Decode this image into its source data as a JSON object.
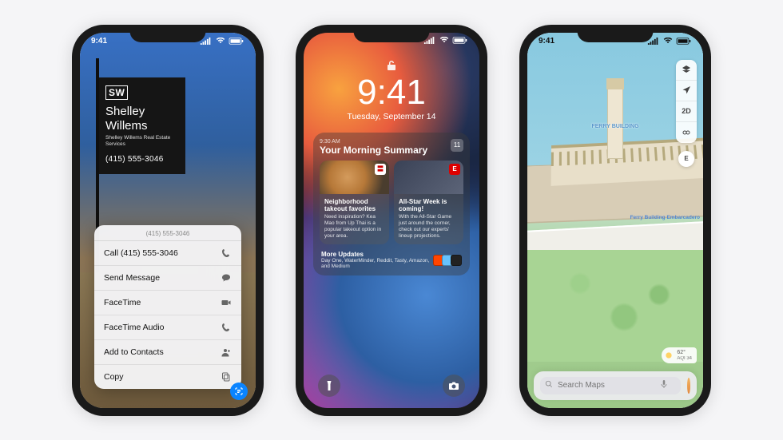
{
  "status_time": "9:41",
  "phone1": {
    "sign": {
      "logo": "SW",
      "name": "Shelley Willems",
      "sub": "Shelley Willems Real Estate Services",
      "phone": "(415) 555-3046"
    },
    "menu_header": "(415) 555-3046",
    "menu": [
      {
        "label": "Call (415) 555-3046",
        "icon": "phone"
      },
      {
        "label": "Send Message",
        "icon": "message"
      },
      {
        "label": "FaceTime",
        "icon": "video"
      },
      {
        "label": "FaceTime Audio",
        "icon": "phone"
      },
      {
        "label": "Add to Contacts",
        "icon": "contact"
      },
      {
        "label": "Copy",
        "icon": "copy"
      }
    ]
  },
  "phone2": {
    "time": "9:41",
    "date": "Tuesday, September 14",
    "summary": {
      "ts": "9:30 AM",
      "title": "Your Morning Summary",
      "count": "11",
      "tiles": [
        {
          "title": "Neighborhood takeout favorites",
          "text": "Need inspiration? Kea Mao from Up Thai is a popular takeout option in your area."
        },
        {
          "title": "All-Star Week is coming!",
          "text": "With the All-Star Game just around the corner, check out our experts' lineup projections."
        }
      ],
      "more_title": "More Updates",
      "more_sub": "Day One, WaterMinder, Reddit, Tasty, Amazon, and Medium"
    }
  },
  "phone3": {
    "controls": {
      "map": "▢",
      "location": "➤",
      "mode": "2D",
      "binoc": "◎"
    },
    "compass": "E",
    "label_ferry": "FERRY BUILDING",
    "label_embarc": "Ferry Building Embarcadero",
    "weather": {
      "temp": "62°",
      "aqi": "AQI 34"
    },
    "search_placeholder": "Search Maps"
  }
}
